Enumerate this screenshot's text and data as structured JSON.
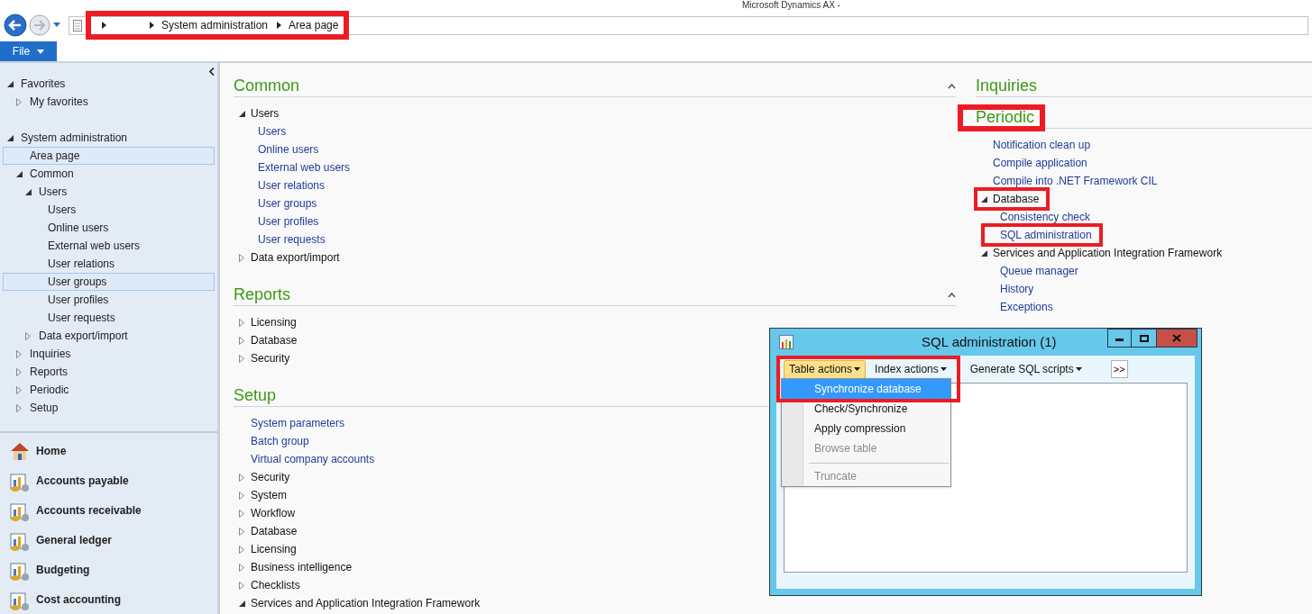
{
  "window": {
    "title": "Microsoft Dynamics AX -"
  },
  "address_bar": {
    "breadcrumb": [
      "System administration",
      "Area page"
    ],
    "annotated": true
  },
  "ribbon": {
    "file_tab": "File"
  },
  "nav": {
    "tree": [
      {
        "label": "Favorites",
        "expanded": true,
        "selected": false,
        "children": [
          {
            "label": "My favorites",
            "expanded": false,
            "selected": false
          }
        ]
      },
      {
        "label": "System administration",
        "expanded": true,
        "selected": false,
        "children": [
          {
            "label": "Area page",
            "selected": true
          },
          {
            "label": "Common",
            "expanded": true,
            "selected": false,
            "children": [
              {
                "label": "Users",
                "expanded": true,
                "selected": false,
                "children": [
                  {
                    "label": "Users",
                    "selected": false
                  },
                  {
                    "label": "Online users",
                    "selected": false
                  },
                  {
                    "label": "External web users",
                    "selected": false
                  },
                  {
                    "label": "User relations",
                    "selected": false
                  },
                  {
                    "label": "User groups",
                    "selected": true
                  },
                  {
                    "label": "User profiles",
                    "selected": false
                  },
                  {
                    "label": "User requests",
                    "selected": false
                  }
                ]
              },
              {
                "label": "Data export/import",
                "expanded": false,
                "selected": false
              }
            ]
          },
          {
            "label": "Inquiries",
            "expanded": false,
            "selected": false
          },
          {
            "label": "Reports",
            "expanded": false,
            "selected": false
          },
          {
            "label": "Periodic",
            "expanded": false,
            "selected": false
          },
          {
            "label": "Setup",
            "expanded": false,
            "selected": false
          }
        ]
      }
    ],
    "modules": [
      "Home",
      "Accounts payable",
      "Accounts receivable",
      "General ledger",
      "Budgeting",
      "Cost accounting"
    ]
  },
  "content": {
    "columns": [
      {
        "sections": [
          {
            "title": "Common",
            "expanded": true,
            "annotated": false,
            "items": [
              {
                "label": "Users",
                "kind": "group",
                "expanded": true,
                "children": [
                  {
                    "label": "Users",
                    "kind": "link"
                  },
                  {
                    "label": "Online users",
                    "kind": "link"
                  },
                  {
                    "label": "External web users",
                    "kind": "link"
                  },
                  {
                    "label": "User relations",
                    "kind": "link"
                  },
                  {
                    "label": "User groups",
                    "kind": "link"
                  },
                  {
                    "label": "User profiles",
                    "kind": "link"
                  },
                  {
                    "label": "User requests",
                    "kind": "link"
                  }
                ]
              },
              {
                "label": "Data export/import",
                "kind": "group",
                "expanded": false
              }
            ]
          },
          {
            "title": "Reports",
            "expanded": true,
            "annotated": false,
            "items": [
              {
                "label": "Licensing",
                "kind": "group",
                "expanded": false
              },
              {
                "label": "Database",
                "kind": "group",
                "expanded": false
              },
              {
                "label": "Security",
                "kind": "group",
                "expanded": false
              }
            ]
          },
          {
            "title": "Setup",
            "expanded": true,
            "annotated": false,
            "items": [
              {
                "label": "System parameters",
                "kind": "link"
              },
              {
                "label": "Batch group",
                "kind": "link"
              },
              {
                "label": "Virtual company accounts",
                "kind": "link"
              },
              {
                "label": "Security",
                "kind": "group",
                "expanded": false
              },
              {
                "label": "System",
                "kind": "group",
                "expanded": false
              },
              {
                "label": "Workflow",
                "kind": "group",
                "expanded": false
              },
              {
                "label": "Database",
                "kind": "group",
                "expanded": false
              },
              {
                "label": "Licensing",
                "kind": "group",
                "expanded": false
              },
              {
                "label": "Business intelligence",
                "kind": "group",
                "expanded": false
              },
              {
                "label": "Checklists",
                "kind": "group",
                "expanded": false
              },
              {
                "label": "Services and Application Integration Framework",
                "kind": "group",
                "expanded": true
              }
            ]
          }
        ]
      },
      {
        "sections": [
          {
            "title": "Inquiries",
            "annotated": false
          },
          {
            "title": "Periodic",
            "annotated": true,
            "items": [
              {
                "label": "Notification clean up",
                "kind": "link",
                "annotated": false
              },
              {
                "label": "Compile application",
                "kind": "link",
                "annotated": false
              },
              {
                "label": "Compile into .NET Framework CIL",
                "kind": "link",
                "annotated": false
              },
              {
                "label": "Database",
                "kind": "group",
                "expanded": true,
                "annotated": true,
                "children": [
                  {
                    "label": "Consistency check",
                    "kind": "link",
                    "annotated": false
                  },
                  {
                    "label": "SQL administration",
                    "kind": "link",
                    "annotated": true
                  }
                ]
              },
              {
                "label": "Services and Application Integration Framework",
                "kind": "group",
                "expanded": true,
                "annotated": false,
                "children": [
                  {
                    "label": "Queue manager",
                    "kind": "link",
                    "annotated": false
                  },
                  {
                    "label": "History",
                    "kind": "link",
                    "annotated": false
                  },
                  {
                    "label": "Exceptions",
                    "kind": "link",
                    "annotated": false
                  }
                ]
              }
            ]
          }
        ]
      }
    ]
  },
  "dialog": {
    "title": "SQL administration (1)",
    "toolbar": [
      {
        "label": "Table actions",
        "kind": "menu",
        "open": true
      },
      {
        "label": "Index actions",
        "kind": "menu",
        "open": false
      },
      {
        "label": "Generate SQL scripts",
        "kind": "menu",
        "open": false
      },
      {
        "label": ">>",
        "kind": "more",
        "open": false
      }
    ],
    "menu": {
      "annotated": true,
      "items": [
        {
          "label": "Synchronize database",
          "kind": "item",
          "selected": true,
          "disabled": false
        },
        {
          "label": "Check/Synchronize",
          "kind": "item",
          "selected": false,
          "disabled": false
        },
        {
          "label": "Apply compression",
          "kind": "item",
          "selected": false,
          "disabled": false
        },
        {
          "label": "Browse table",
          "kind": "item",
          "selected": false,
          "disabled": true
        },
        {
          "kind": "separator"
        },
        {
          "label": "Truncate",
          "kind": "item",
          "selected": false,
          "disabled": true
        }
      ]
    }
  }
}
